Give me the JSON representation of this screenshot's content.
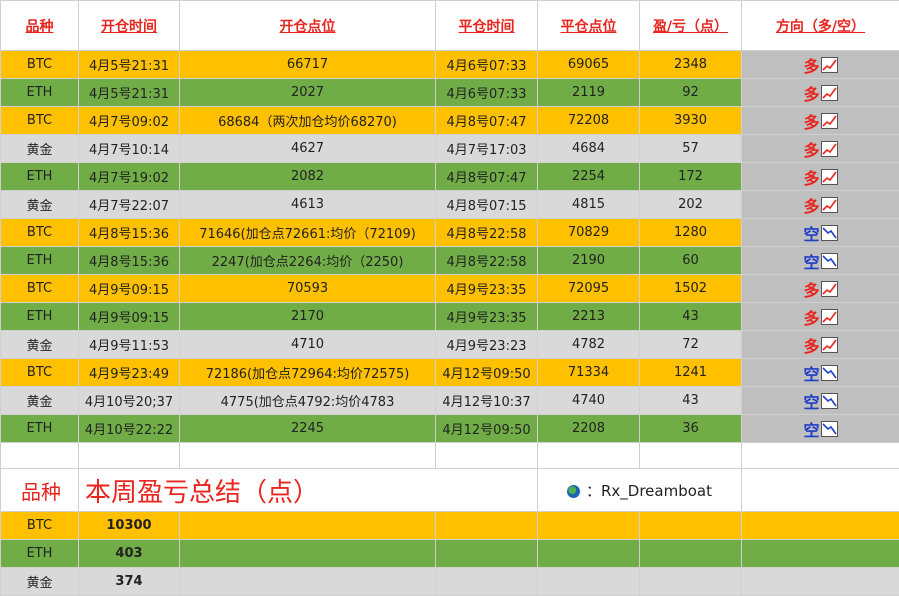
{
  "headers": {
    "variety": "品种",
    "open_time": "开仓时间",
    "open_price": "开仓点位",
    "close_time": "平仓时间",
    "close_price": "平仓点位",
    "pnl": "盈/亏（点）",
    "direction": "方向（多/空）"
  },
  "colors": {
    "orange": "#ffc000",
    "green": "#70ad47",
    "gray": "#d9d9d9",
    "direction_cell": "#bfbfbf",
    "red": "#e8251f",
    "blue": "#1f3ec7"
  },
  "trades": [
    {
      "variety": "BTC",
      "open_time": "4月5号21:31",
      "open_price": "66717",
      "close_time": "4月6号07:33",
      "close_price": "69065",
      "pnl": "2348",
      "direction": "多",
      "row_color": "orange",
      "icon": "chart-up-icon"
    },
    {
      "variety": "ETH",
      "open_time": "4月5号21:31",
      "open_price": "2027",
      "close_time": "4月6号07:33",
      "close_price": "2119",
      "pnl": "92",
      "direction": "多",
      "row_color": "green",
      "icon": "chart-up-icon"
    },
    {
      "variety": "BTC",
      "open_time": "4月7号09:02",
      "open_price": "68684（两次加仓均价68270)",
      "close_time": "4月8号07:47",
      "close_price": "72208",
      "pnl": "3930",
      "direction": "多",
      "row_color": "orange",
      "icon": "chart-up-icon"
    },
    {
      "variety": "黄金",
      "open_time": "4月7号10:14",
      "open_price": "4627",
      "close_time": "4月7号17:03",
      "close_price": "4684",
      "pnl": "57",
      "direction": "多",
      "row_color": "gray",
      "icon": "chart-up-icon"
    },
    {
      "variety": "ETH",
      "open_time": "4月7号19:02",
      "open_price": "2082",
      "close_time": "4月8号07:47",
      "close_price": "2254",
      "pnl": "172",
      "direction": "多",
      "row_color": "green",
      "icon": "chart-up-icon"
    },
    {
      "variety": "黄金",
      "open_time": "4月7号22:07",
      "open_price": "4613",
      "close_time": "4月8号07:15",
      "close_price": "4815",
      "pnl": "202",
      "direction": "多",
      "row_color": "gray",
      "icon": "chart-up-icon"
    },
    {
      "variety": "BTC",
      "open_time": "4月8号15:36",
      "open_price": "71646(加仓点72661:均价（72109)",
      "close_time": "4月8号22:58",
      "close_price": "70829",
      "pnl": "1280",
      "direction": "空",
      "row_color": "orange",
      "icon": "chart-down-icon"
    },
    {
      "variety": "ETH",
      "open_time": "4月8号15:36",
      "open_price": "2247(加仓点2264:均价（2250)",
      "close_time": "4月8号22:58",
      "close_price": "2190",
      "pnl": "60",
      "direction": "空",
      "row_color": "green",
      "icon": "chart-down-icon"
    },
    {
      "variety": "BTC",
      "open_time": "4月9号09:15",
      "open_price": "70593",
      "close_time": "4月9号23:35",
      "close_price": "72095",
      "pnl": "1502",
      "direction": "多",
      "row_color": "orange",
      "icon": "chart-up-icon"
    },
    {
      "variety": "ETH",
      "open_time": "4月9号09:15",
      "open_price": "2170",
      "close_time": "4月9号23:35",
      "close_price": "2213",
      "pnl": "43",
      "direction": "多",
      "row_color": "green",
      "icon": "chart-up-icon"
    },
    {
      "variety": "黄金",
      "open_time": "4月9号11:53",
      "open_price": "4710",
      "close_time": "4月9号23:23",
      "close_price": "4782",
      "pnl": "72",
      "direction": "多",
      "row_color": "gray",
      "icon": "chart-up-icon"
    },
    {
      "variety": "BTC",
      "open_time": "4月9号23:49",
      "open_price": "72186(加仓点72964:均价72575)",
      "close_time": "4月12号09:50",
      "close_price": "71334",
      "pnl": "1241",
      "direction": "空",
      "row_color": "orange",
      "icon": "chart-down-icon"
    },
    {
      "variety": "黄金",
      "open_time": "4月10号20;37",
      "open_price": "4775(加仓点4792:均价4783",
      "close_time": "4月12号10:37",
      "close_price": "4740",
      "pnl": "43",
      "direction": "空",
      "row_color": "gray",
      "icon": "chart-down-icon"
    },
    {
      "variety": "ETH",
      "open_time": "4月10号22:22",
      "open_price": "2245",
      "close_time": "4月12号09:50",
      "close_price": "2208",
      "pnl": "36",
      "direction": "空",
      "row_color": "green",
      "icon": "chart-down-icon"
    }
  ],
  "summary": {
    "variety_label": "品种",
    "title": "本周盈亏总结（点）",
    "watermark": "：Rx_Dreamboat",
    "rows": [
      {
        "variety": "BTC",
        "total": "10300",
        "row_color": "orange"
      },
      {
        "variety": "ETH",
        "total": "403",
        "row_color": "green"
      },
      {
        "variety": "黄金",
        "total": "374",
        "row_color": "gray"
      }
    ]
  }
}
